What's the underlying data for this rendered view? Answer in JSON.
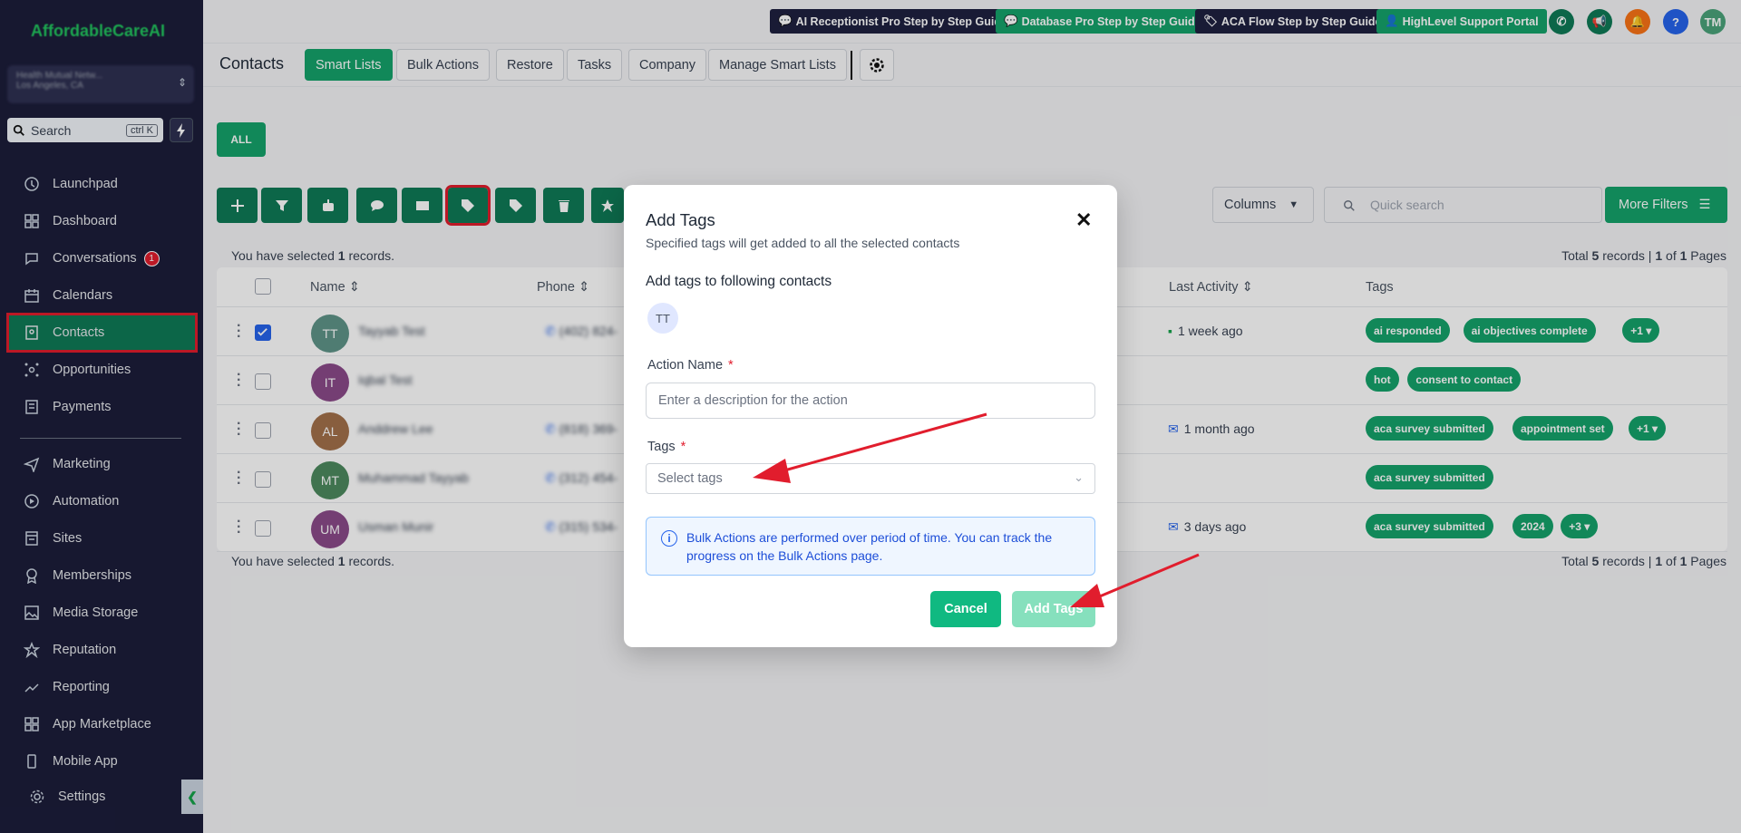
{
  "sidebar": {
    "logo": "AffordableCareAI",
    "account_line1": "Health Mutual Netw...",
    "account_line2": "Los Angeles, CA",
    "search_label": "Search",
    "search_kbd": "ctrl K",
    "items": [
      {
        "label": "Launchpad",
        "icon": "rocket-icon"
      },
      {
        "label": "Dashboard",
        "icon": "grid-icon"
      },
      {
        "label": "Conversations",
        "icon": "chat-icon",
        "badge": "1"
      },
      {
        "label": "Calendars",
        "icon": "calendar-icon"
      },
      {
        "label": "Contacts",
        "icon": "contacts-icon",
        "active": true
      },
      {
        "label": "Opportunities",
        "icon": "opportunities-icon"
      },
      {
        "label": "Payments",
        "icon": "payments-icon"
      },
      {
        "label": "Marketing",
        "icon": "send-icon"
      },
      {
        "label": "Automation",
        "icon": "automation-icon"
      },
      {
        "label": "Sites",
        "icon": "sites-icon"
      },
      {
        "label": "Memberships",
        "icon": "badge-icon"
      },
      {
        "label": "Media Storage",
        "icon": "image-icon"
      },
      {
        "label": "Reputation",
        "icon": "star-icon"
      },
      {
        "label": "Reporting",
        "icon": "trend-icon"
      },
      {
        "label": "App Marketplace",
        "icon": "apps-icon"
      },
      {
        "label": "Mobile App",
        "icon": "phone-icon"
      },
      {
        "label": "Settings",
        "icon": "gear-icon"
      }
    ]
  },
  "topbar": {
    "guides": [
      {
        "label": "AI Receptionist Pro Step by Step Guide",
        "color": "#1e2140"
      },
      {
        "label": "Database Pro Step by Step Guide",
        "color": "#15a36b"
      },
      {
        "label": "ACA Flow Step by Step Guide",
        "color": "#1e2140"
      },
      {
        "label": "HighLevel Support Portal",
        "color": "#15a36b"
      }
    ],
    "avatar_initials": "TM"
  },
  "subbar": {
    "title": "Contacts",
    "tabs": [
      "Smart Lists",
      "Bulk Actions",
      "Restore",
      "Tasks",
      "Company",
      "Manage Smart Lists"
    ]
  },
  "list": {
    "all_label": "ALL",
    "columns_label": "Columns",
    "quick_search_placeholder": "Quick search",
    "more_filters_label": "More Filters",
    "selected_prefix": "You have selected ",
    "selected_count": "1",
    "selected_suffix": " records.",
    "total_prefix": "Total ",
    "total_count": "5",
    "total_mid": " records | ",
    "page_current": "1",
    "page_of": " of ",
    "page_total": "1",
    "page_suffix": " Pages",
    "headers": {
      "name": "Name",
      "phone": "Phone",
      "last_activity": "Last Activity",
      "tags": "Tags"
    }
  },
  "rows": [
    {
      "initials": "TT",
      "color": "#5f9488",
      "name": "Tayyab Test",
      "phone": "(402) 824-",
      "checked": true,
      "activity": "1 week ago",
      "activity_icon": "chat-icon",
      "tags": [
        "ai responded",
        "ai objectives complete"
      ],
      "more": "+1"
    },
    {
      "initials": "IT",
      "color": "#8b4a8a",
      "name": "Iqbal Test",
      "phone": "",
      "checked": false,
      "activity": "",
      "activity_icon": "",
      "tags": [
        "hot",
        "consent to contact"
      ],
      "more": ""
    },
    {
      "initials": "AL",
      "color": "#a3704b",
      "name": "Anddrew Lee",
      "phone": "(818) 369-",
      "checked": false,
      "activity": "1 month ago",
      "activity_icon": "mail-icon",
      "tags": [
        "aca survey submitted",
        "appointment set"
      ],
      "more": "+1"
    },
    {
      "initials": "MT",
      "color": "#4d8a5f",
      "name": "Muhammad Tayyab",
      "phone": "(312) 454-",
      "checked": false,
      "activity": "",
      "activity_icon": "",
      "tags": [
        "aca survey submitted"
      ],
      "more": ""
    },
    {
      "initials": "UM",
      "color": "#8b4a8a",
      "name": "Usman Munir",
      "phone": "(315) 534-",
      "checked": false,
      "activity": "3 days ago",
      "activity_icon": "mail-icon",
      "tags": [
        "aca survey submitted",
        "2024"
      ],
      "more": "+3"
    }
  ],
  "modal": {
    "title": "Add Tags",
    "subtitle": "Specified tags will get added to all the selected contacts",
    "contacts_heading": "Add tags to following contacts",
    "contact_initials": "TT",
    "action_label": "Action Name",
    "action_placeholder": "Enter a description for the action",
    "tags_label": "Tags",
    "tags_placeholder": "Select tags",
    "required_mark": "*",
    "info_text": "Bulk Actions are performed over period of time. You can track the progress on the Bulk Actions page.",
    "cancel_label": "Cancel",
    "submit_label": "Add Tags"
  }
}
